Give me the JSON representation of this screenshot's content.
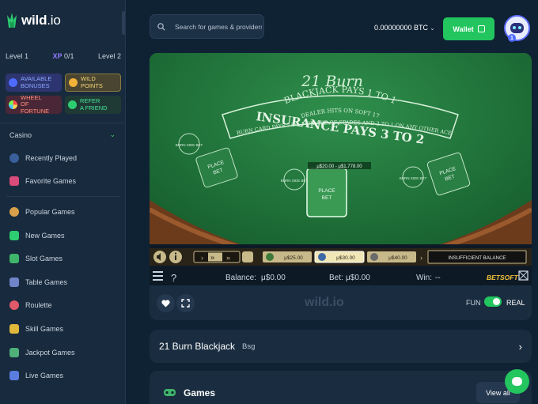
{
  "brand": {
    "name": "wild",
    "tld": ".io"
  },
  "level": {
    "current": "Level 1",
    "xp_label": "XP",
    "xp_value": "0/1",
    "next": "Level 2"
  },
  "promos": [
    {
      "line1": "AVAILABLE",
      "line2": "BONUSES"
    },
    {
      "line1": "WILD",
      "line2": "POINTS"
    },
    {
      "line1": "WHEEL",
      "line2": "OF FORTUNE"
    },
    {
      "line1": "REFER",
      "line2": "A FRIEND"
    }
  ],
  "sidebar": {
    "category": "Casino",
    "items_top": [
      "Recently Played",
      "Favorite Games"
    ],
    "items": [
      "Popular Games",
      "New Games",
      "Slot Games",
      "Table Games",
      "Roulette",
      "Skill Games",
      "Jackpot Games",
      "Live Games"
    ]
  },
  "search": {
    "placeholder": "Search for games & providers"
  },
  "header": {
    "balance": "0.00000000 BTC",
    "wallet_label": "Wallet",
    "badge": "1"
  },
  "game": {
    "table_title": "21 Burn",
    "arc1": "BLACKJACK PAYS 1 TO 1",
    "arc2": "DEALER HITS ON SOFT 17",
    "insurance": "INSURANCE PAYS 3 TO 2",
    "burn_text": "BURN CARD PAYS 7 TO 1 ON ACE OF SPADES AND 2 TO 1 ON ANY OTHER ACE",
    "place_bet": "PLACE",
    "bet": "BET",
    "burn_side_bet": "BURN SIDE BET",
    "limits": "μ$20.00 - μ$1,778.00",
    "chips": [
      "μ$25.00",
      "μ$30.00",
      "μ$40.00"
    ],
    "insufficient": "INSUFFICIENT BALANCE",
    "balance_label": "Balance:",
    "balance_value": "μ$0.00",
    "bet_label": "Bet:",
    "bet_value": "μ$0.00",
    "win_label": "Win:",
    "win_value": "--",
    "provider_logo": "BETSOFT"
  },
  "controls": {
    "watermark": "wild.io",
    "fun": "FUN",
    "real": "REAL"
  },
  "game_title": {
    "name": "21 Burn Blackjack",
    "provider": "Bsg"
  },
  "games_section": {
    "title": "Games",
    "view_all": "View all"
  },
  "colors": {
    "accent_green": "#22c55e",
    "sidebar_bg": "#182a3d",
    "page_bg": "#0f2233",
    "felt": "#1d6b3a"
  }
}
